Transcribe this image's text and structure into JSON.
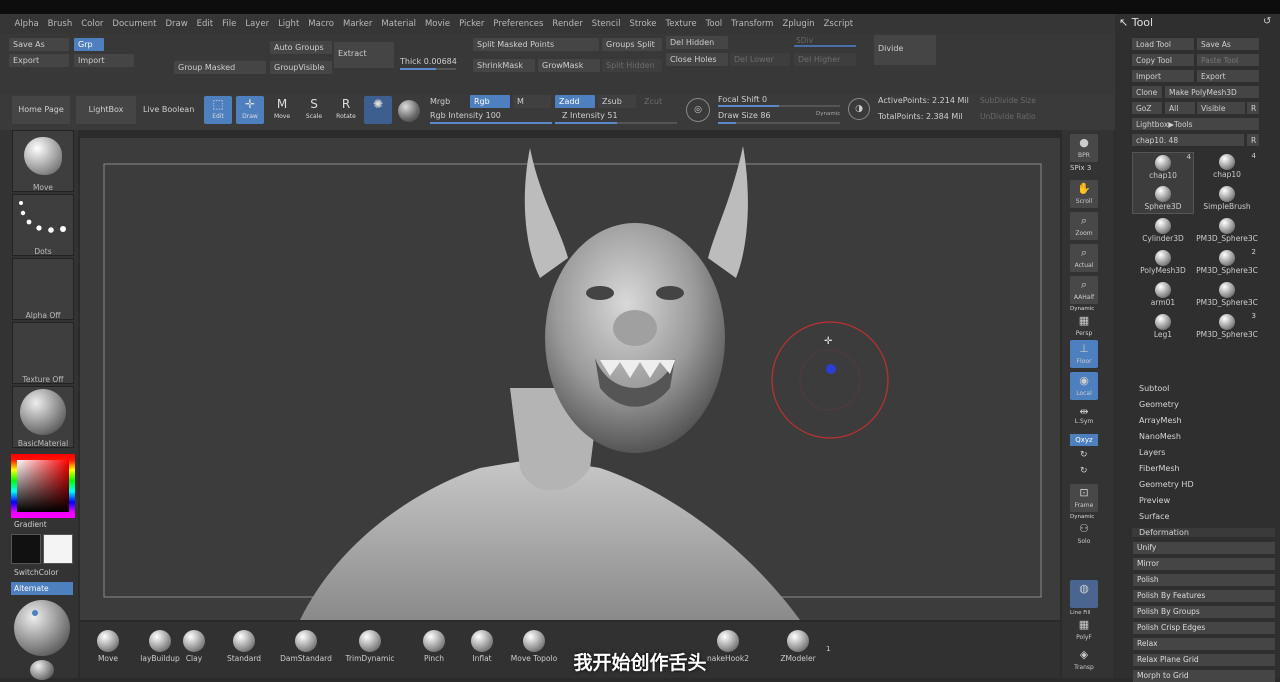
{
  "menus": [
    "Alpha",
    "Brush",
    "Color",
    "Document",
    "Draw",
    "Edit",
    "File",
    "Layer",
    "Light",
    "Macro",
    "Marker",
    "Material",
    "Movie",
    "Picker",
    "Preferences",
    "Render",
    "Stencil",
    "Stroke",
    "Texture",
    "Tool",
    "Transform",
    "Zplugin",
    "Zscript"
  ],
  "toolbar1": {
    "save_as": "Save As",
    "grp": "Grp",
    "export": "Export",
    "import": "Import",
    "group_masked": "Group Masked",
    "auto_groups": "Auto Groups",
    "group_visible": "GroupVisible",
    "extract": "Extract",
    "thick_label": "Thick",
    "thick_value": "0.00684",
    "split_masked_points": "Split Masked Points",
    "groups_split": "Groups Split",
    "shrink_mask": "ShrinkMask",
    "grow_mask": "GrowMask",
    "split_hidden": "Split Hidden",
    "del_hidden": "Del Hidden",
    "close_holes": "Close Holes",
    "del_lower": "Del Lower",
    "del_higher": "Del Higher",
    "sdiv": "SDiv",
    "divide": "Divide"
  },
  "toolbar2": {
    "home_page": "Home Page",
    "lightbox": "LightBox",
    "live_boolean": "Live Boolean",
    "edit": "Edit",
    "draw": "Draw",
    "move": "Move",
    "scale": "Scale",
    "rotate": "Rotate",
    "mrgb": "Mrgb",
    "rgb": "Rgb",
    "m": "M",
    "rgb_intensity_label": "Rgb Intensity",
    "rgb_intensity": "100",
    "zadd": "Zadd",
    "zsub": "Zsub",
    "zcut": "Zcut",
    "z_intensity_label": "Z Intensity",
    "z_intensity": "51",
    "focal_shift_label": "Focal Shift",
    "focal_shift": "0",
    "draw_size_label": "Draw Size",
    "draw_size": "86",
    "dynamic": "Dynamic",
    "active_points": "ActivePoints: 2.214 Mil",
    "total_points": "TotalPoints: 2.384 Mil",
    "subdivide_size": "SubDivide Size",
    "undivide_ratio": "UnDivide Ratio"
  },
  "left": {
    "move": "Move",
    "dots": "Dots",
    "alpha_off": "Alpha Off",
    "texture_off": "Texture Off",
    "basic_material": "BasicMaterial",
    "gradient": "Gradient",
    "switch_color": "SwitchColor",
    "alternate": "Alternate"
  },
  "right_strip": {
    "bpr": "BPR",
    "spix_label": "SPix",
    "spix": "3",
    "scroll": "Scroll",
    "zoom": "Zoom",
    "actual": "Actual",
    "aahalf": "AAHalf",
    "dynamic": "Dynamic",
    "persp": "Persp",
    "floor": "Floor",
    "local": "Local",
    "lsym": "L.Sym",
    "qxyz": "Qxyz",
    "frame": "Frame",
    "dynamic2": "Dynamic",
    "solo": "Solo",
    "line_fill": "Line Fill",
    "polyf": "PolyF",
    "transp": "Transp"
  },
  "tool": {
    "title": "Tool",
    "load_tool": "Load Tool",
    "save_as": "Save As",
    "copy_tool": "Copy Tool",
    "paste_tool": "Paste Tool",
    "import": "Import",
    "export": "Export",
    "clone": "Clone",
    "make_polymesh": "Make PolyMesh3D",
    "goz": "GoZ",
    "all": "All",
    "visible": "Visible",
    "r": "R",
    "lightbox_tools": "Lightbox▶Tools",
    "chap_slider": "chap10. 48",
    "thumbs": [
      {
        "label": "chap10",
        "count": "4"
      },
      {
        "label": "chap10",
        "count": "4"
      },
      {
        "label": "Sphere3D",
        "count": ""
      },
      {
        "label": "SimpleBrush",
        "count": ""
      },
      {
        "label": "Cylinder3D",
        "count": ""
      },
      {
        "label": "PM3D_Sphere3C",
        "count": ""
      },
      {
        "label": "PolyMesh3D",
        "count": ""
      },
      {
        "label": "PM3D_Sphere3C",
        "count": "2"
      },
      {
        "label": "arm01",
        "count": ""
      },
      {
        "label": "PM3D_Sphere3C",
        "count": ""
      },
      {
        "label": "Leg1",
        "count": ""
      },
      {
        "label": "PM3D_Sphere3C",
        "count": "3"
      }
    ],
    "sections": [
      "Subtool",
      "Geometry",
      "ArrayMesh",
      "NanoMesh",
      "Layers",
      "FiberMesh",
      "Geometry HD",
      "Preview",
      "Surface",
      "Deformation"
    ],
    "deformation": [
      "Unify",
      "Mirror",
      "Polish",
      "Polish By Features",
      "Polish By Groups",
      "Polish Crisp Edges",
      "Relax",
      "Relax Plane Grid",
      "Morph to Grid"
    ]
  },
  "brushes": [
    {
      "label": "Move"
    },
    {
      "label": "layBuildup"
    },
    {
      "label": "Clay"
    },
    {
      "label": "Standard"
    },
    {
      "label": "DamStandard"
    },
    {
      "label": "TrimDynamic"
    },
    {
      "label": "Pinch"
    },
    {
      "label": "Inflat"
    },
    {
      "label": "Move Topolo"
    },
    {
      "label": "nakeHook2"
    },
    {
      "label": "ZModeler"
    }
  ],
  "brush_count": "1",
  "subtitle": "我开始创作舌头"
}
